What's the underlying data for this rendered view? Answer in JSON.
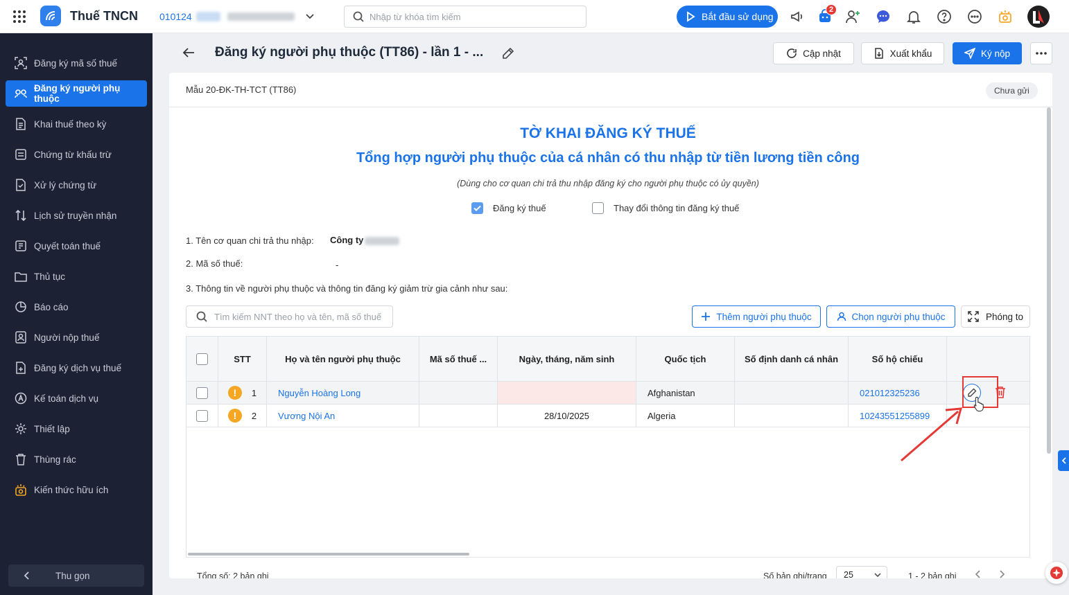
{
  "app": {
    "title": "Thuế TNCN",
    "mst": "010124",
    "search_placeholder": "Nhập từ khóa tìm kiếm",
    "start_label": "Bắt đầu sử dụng",
    "cart_count": "2"
  },
  "sidebar": {
    "items": [
      {
        "label": "Đăng ký mã số thuế",
        "icon": "scan-icon"
      },
      {
        "label": "Đăng ký người phụ thuộc",
        "icon": "people-icon",
        "active": true
      },
      {
        "label": "Khai thuế theo kỳ",
        "icon": "doc-icon"
      },
      {
        "label": "Chứng từ khấu trừ",
        "icon": "voucher-icon"
      },
      {
        "label": "Xử lý chứng từ",
        "icon": "doc-check-icon"
      },
      {
        "label": "Lịch sử truyền nhận",
        "icon": "transfer-icon"
      },
      {
        "label": "Quyết toán thuế",
        "icon": "settle-icon"
      },
      {
        "label": "Thủ tục",
        "icon": "folder-icon"
      },
      {
        "label": "Báo cáo",
        "icon": "chart-icon"
      },
      {
        "label": "Người nộp thuế",
        "icon": "user-doc-icon"
      },
      {
        "label": "Đăng ký dịch vụ thuế",
        "icon": "service-icon"
      },
      {
        "label": "Kế toán dịch vụ",
        "icon": "accounting-icon"
      },
      {
        "label": "Thiết lập",
        "icon": "gear-icon"
      },
      {
        "label": "Thùng rác",
        "icon": "trash-icon"
      },
      {
        "label": "Kiến thức hữu ích",
        "icon": "bulb-icon"
      }
    ],
    "collapse_label": "Thu gọn"
  },
  "header": {
    "title": "Đăng ký người phụ thuộc (TT86) - lần 1 - ...",
    "refresh_label": "Cập nhật",
    "export_label": "Xuất khẩu",
    "submit_label": "Ký nộp"
  },
  "form": {
    "code": "Mẫu 20-ĐK-TH-TCT (TT86)",
    "status": "Chưa gửi",
    "heading1": "TỜ KHAI ĐĂNG KÝ THUẾ",
    "heading2": "Tổng hợp người phụ thuộc của cá nhân có thu nhập từ tiền lương tiền công",
    "note": "(Dùng cho cơ quan chi trả thu nhập đăng ký cho người phụ thuộc có ủy quyền)",
    "check_register": "Đăng ký thuế",
    "check_change": "Thay đổi thông tin đăng ký thuế",
    "field1_label": "1. Tên cơ quan chi trả thu nhập:",
    "field1_value": "Công ty",
    "field2_label": "2. Mã số thuế:",
    "field2_value": "-",
    "field3_label": "3. Thông tin về người phụ thuộc và thông tin đăng ký giảm trừ gia cảnh như sau:"
  },
  "table_tools": {
    "search_placeholder": "Tìm kiếm NNT theo họ và tên, mã số thuế",
    "add_label": "Thêm người phụ thuộc",
    "choose_label": "Chọn người phụ thuộc",
    "zoom_label": "Phóng to"
  },
  "table": {
    "columns": [
      "STT",
      "Họ và tên người phụ thuộc",
      "Mã số thuế ...",
      "Ngày, tháng, năm sinh",
      "Quốc tịch",
      "Số định danh cá nhân",
      "Số hộ chiếu"
    ],
    "rows": [
      {
        "stt": "1",
        "name": "Nguyễn Hoàng Long",
        "mst": "",
        "dob": "",
        "nationality": "Afghanistan",
        "id": "",
        "passport": "021012325236"
      },
      {
        "stt": "2",
        "name": "Vương Nội An",
        "mst": "",
        "dob": "28/10/2025",
        "nationality": "Algeria",
        "id": "",
        "passport": "10243551255899"
      }
    ]
  },
  "footer": {
    "total": "Tổng số: 2 bản ghi",
    "per_page_label": "Số bản ghi/trang",
    "per_page": "25",
    "range": "1 - 2 bản ghi"
  }
}
